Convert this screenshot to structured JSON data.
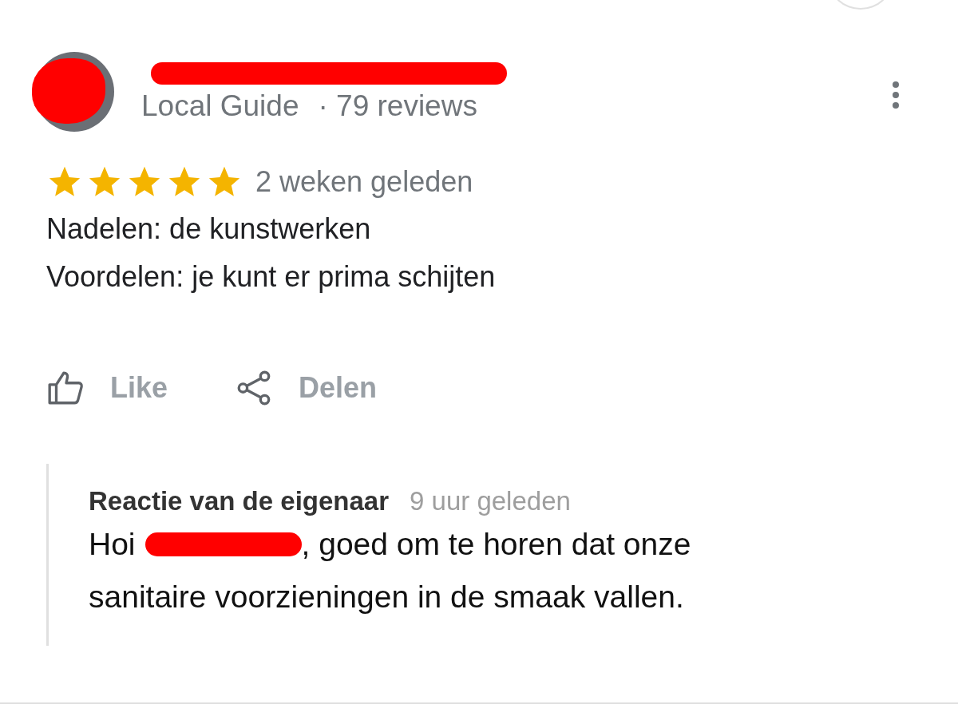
{
  "author": {
    "name_redacted": true,
    "badge": "Local Guide",
    "review_count": "· 79 reviews"
  },
  "review": {
    "stars": 5,
    "time": "2 weken geleden",
    "lines": [
      "Nadelen: de kunstwerken",
      "Voordelen: je kunt er prima schijten"
    ]
  },
  "actions": [
    {
      "kind": "like",
      "label": "Like"
    },
    {
      "kind": "share",
      "label": "Delen"
    }
  ],
  "owner_reply": {
    "title": "Reactie van de eigenaar",
    "time": "9 uur geleden",
    "greeting": "Hoi",
    "name_redacted": true,
    "text_lines": [
      ", goed om te horen dat onze",
      "sanitaire voorzieningen in de smaak vallen."
    ]
  }
}
